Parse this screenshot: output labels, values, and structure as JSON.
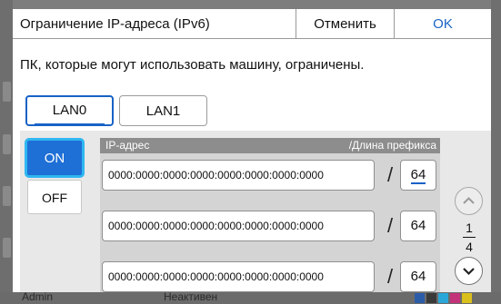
{
  "dialog": {
    "title": "Ограничение IP-адреса (IPv6)",
    "cancel_label": "Отменить",
    "ok_label": "OK",
    "description": "ПК, которые могут использовать машину, ограничены."
  },
  "tabs": [
    {
      "label": "LAN0",
      "selected": true
    },
    {
      "label": "LAN1",
      "selected": false
    }
  ],
  "toggle": {
    "on_label": "ON",
    "off_label": "OFF",
    "selected": "ON"
  },
  "list": {
    "header_ip": "IP-адрес",
    "header_prefix": "/Длина префикса",
    "separator": "/",
    "rows": [
      {
        "ip": "0000:0000:0000:0000:0000:0000:0000:0000",
        "prefix": "64"
      },
      {
        "ip": "0000:0000:0000:0000:0000:0000:0000:0000",
        "prefix": "64"
      },
      {
        "ip": "0000:0000:0000:0000:0000:0000:0000:0000",
        "prefix": "64"
      }
    ]
  },
  "pagination": {
    "current": "1",
    "total": "4"
  },
  "background": {
    "status_user": "Admin",
    "status_state": "Неактивен",
    "ink_labels": [
      "K",
      "C",
      "M",
      "Y"
    ]
  },
  "colors": {
    "accent": "#1862c6",
    "on_button": "#1e6fd6",
    "focus_ring": "#2fb7f0",
    "panel": "#e8e8e8",
    "list_header": "#8d8d8d"
  }
}
